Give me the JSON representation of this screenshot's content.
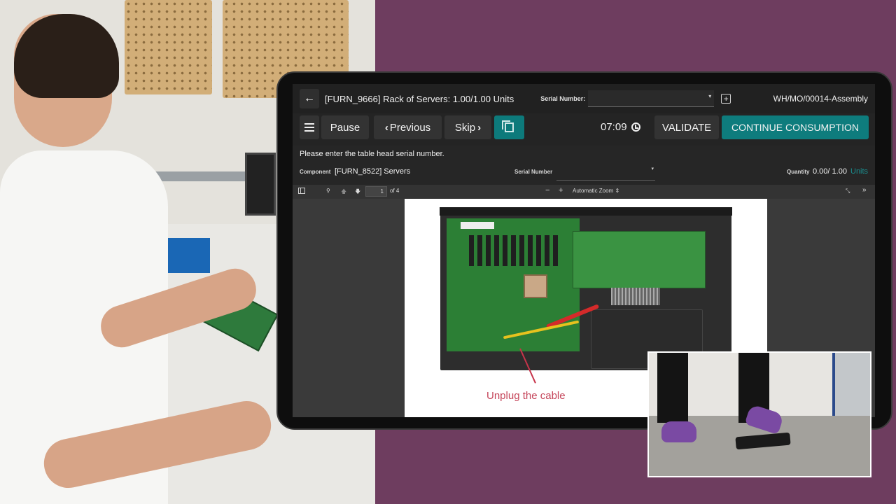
{
  "header": {
    "work_order_title": "[FURN_9666] Rack of Servers: 1.00/1.00 Units",
    "serial_number_label": "Serial Number:",
    "serial_number_value": "",
    "mo_reference": "WH/MO/00014-Assembly"
  },
  "toolbar": {
    "pause_label": "Pause",
    "previous_label": "Previous",
    "skip_label": "Skip",
    "timer": "07:09",
    "validate_label": "VALIDATE",
    "continue_label": "CONTINUE CONSUMPTION"
  },
  "step": {
    "instruction": "Please enter the table head serial number.",
    "component_label": "Component",
    "component_value": "[FURN_8522] Servers",
    "serial_label": "Serial Number",
    "serial_value": "",
    "quantity_label": "Quantity",
    "quantity_value": "0.00/ 1.00",
    "quantity_unit": "Units"
  },
  "pdf_viewer": {
    "current_page": "1",
    "page_total": "of 4",
    "zoom": "Automatic Zoom",
    "annotation": "Unplug the cable"
  },
  "colors": {
    "accent_teal": "#0e7c7d",
    "background_purple": "#6e3d5f",
    "annotation_red": "#c5455a"
  }
}
